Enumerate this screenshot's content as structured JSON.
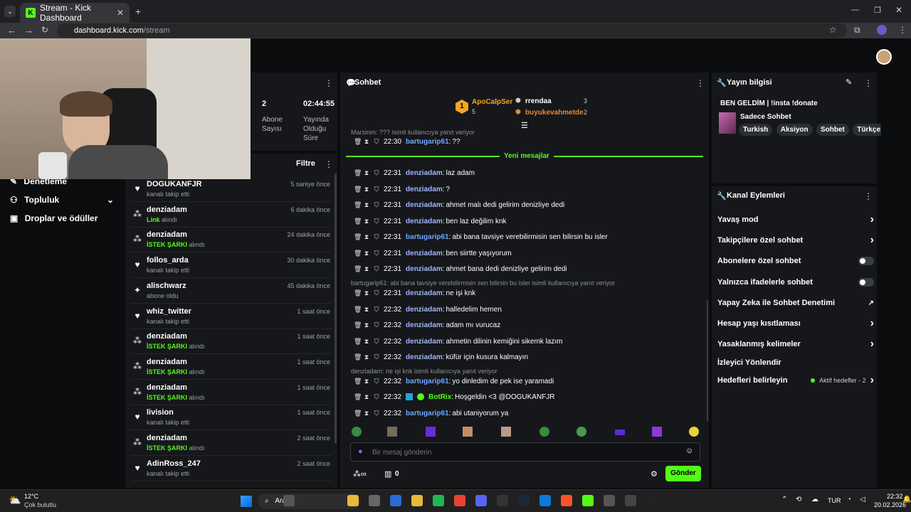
{
  "browser": {
    "tab_title": "Stream - Kick Dashboard",
    "url_host": "dashboard.kick.com",
    "url_path": "/stream"
  },
  "stats": {
    "subscribers_value": "2",
    "subscribers_label": "Abone Sayısı",
    "uptime_value": "02:44:55",
    "uptime_label": "Yayında Olduğu Süre"
  },
  "sidebar": {
    "items": [
      {
        "label": "Denetleme"
      },
      {
        "label": "Topluluk"
      },
      {
        "label": "Droplar ve ödüller"
      }
    ]
  },
  "activity": {
    "filter_label": "Filtre",
    "items": [
      {
        "name": "DOGUKANFJR",
        "highlight": "",
        "detail": "kanalı takip etti",
        "time": "5 saniye önce",
        "icon": "heart-icon"
      },
      {
        "name": "denziadam",
        "highlight": "Link",
        "detail": "alındı",
        "time": "6 dakika önce",
        "icon": "kick-points-icon"
      },
      {
        "name": "denziadam",
        "highlight": "İSTEK ŞARKI",
        "detail": "alındı",
        "time": "24 dakika önce",
        "icon": "kick-points-icon"
      },
      {
        "name": "follos_arda",
        "highlight": "",
        "detail": "kanalı takip etti",
        "time": "30 dakika önce",
        "icon": "heart-icon"
      },
      {
        "name": "alischwarz",
        "highlight": "",
        "detail": "abone oldu",
        "time": "45 dakika önce",
        "icon": "star-icon"
      },
      {
        "name": "whiz_twitter",
        "highlight": "",
        "detail": "kanalı takip etti",
        "time": "1 saat önce",
        "icon": "heart-icon"
      },
      {
        "name": "denziadam",
        "highlight": "İSTEK ŞARKI",
        "detail": "alındı",
        "time": "1 saat önce",
        "icon": "kick-points-icon"
      },
      {
        "name": "denziadam",
        "highlight": "İSTEK ŞARKI",
        "detail": "alındı",
        "time": "1 saat önce",
        "icon": "kick-points-icon"
      },
      {
        "name": "denziadam",
        "highlight": "İSTEK ŞARKI",
        "detail": "alındı",
        "time": "1 saat önce",
        "icon": "kick-points-icon"
      },
      {
        "name": "livision",
        "highlight": "",
        "detail": "kanalı takip etti",
        "time": "1 saat önce",
        "icon": "heart-icon"
      },
      {
        "name": "denziadam",
        "highlight": "İSTEK ŞARKI",
        "detail": "alındı",
        "time": "2 saat önce",
        "icon": "kick-points-icon"
      },
      {
        "name": "AdinRoss_247",
        "highlight": "",
        "detail": "kanalı takip etti",
        "time": "2 saat önce",
        "icon": "heart-icon"
      }
    ]
  },
  "chat": {
    "title": "Sohbet",
    "leaderboard": {
      "first_name": "ApoCalpSer",
      "first_count": "5",
      "rank": "1",
      "second_name": "rrendaa",
      "second_count": "3",
      "third_name": "buyukevahmetde",
      "third_count": "2"
    },
    "top_reply_note": "Marsiren: ??? isimli kullanıcıya yanıt veriyor",
    "new_messages_label": "Yeni mesajlar",
    "messages": [
      {
        "time": "22:30",
        "user": "bartugarip61",
        "text": "??"
      },
      {
        "time": "22:31",
        "user": "denziadam",
        "text": "laz adam"
      },
      {
        "time": "22:31",
        "user": "denziadam",
        "text": "?"
      },
      {
        "time": "22:31",
        "user": "denziadam",
        "text": "ahmet malı dedi gelirim denizliye dedi"
      },
      {
        "time": "22:31",
        "user": "denziadam",
        "text": "ben laz değilim knk"
      },
      {
        "time": "22:31",
        "user": "bartugarip61",
        "text": "abi bana tavsiye verebilirmisin sen bilirsin bu isler"
      },
      {
        "time": "22:31",
        "user": "denziadam",
        "text": "ben siirtte yaşıyorum"
      },
      {
        "time": "22:31",
        "user": "denziadam",
        "text": "ahmet bana dedi denizliye gelirim dedi"
      },
      {
        "time": "22:31",
        "user": "denziadam",
        "text": "ne işi knk"
      },
      {
        "time": "22:32",
        "user": "denziadam",
        "text": "halledelim hemen"
      },
      {
        "time": "22:32",
        "user": "denziadam",
        "text": "adam mı vurucaz"
      },
      {
        "time": "22:32",
        "user": "denziadam",
        "text": "ahmetin dilinin kemiğini sikemk lazım"
      },
      {
        "time": "22:32",
        "user": "denziadam",
        "text": "küfür için kusura kalmayın"
      },
      {
        "time": "22:32",
        "user": "bartugarip61",
        "text": "yo dinledim de pek ise yaramadi"
      },
      {
        "time": "22:32",
        "user": "BotRix",
        "text": "Hoşgeldin <3 @DOGUKANFJR"
      },
      {
        "time": "22:32",
        "user": "bartugarip61",
        "text": "abi utaniyorum ya"
      }
    ],
    "reply_notes": [
      "bartugarip61: abi bana tavsiye verebilirmisin sen bilirsin bu isler isimli kullanıcıya yanıt veriyor",
      "denziadam: ne işi knk isimli kullanıcıya yanıt veriyor"
    ],
    "input_placeholder": "Bir mesaj gönderin",
    "send_label": "Gönder",
    "points_count": "0"
  },
  "stream_info": {
    "title": "Yayın bilgisi",
    "stream_title": "BEN GELDİM | !insta !donate",
    "category": "Sadece Sohbet",
    "tags": [
      "Turkish",
      "Aksiyon",
      "Sohbet",
      "Türkçe"
    ]
  },
  "channel_actions": {
    "title": "Kanal Eylemleri",
    "rows": [
      {
        "label": "Yavaş mod",
        "control": "chevron"
      },
      {
        "label": "Takipçilere özel sohbet",
        "control": "chevron"
      },
      {
        "label": "Abonelere özel sohbet",
        "control": "toggle"
      },
      {
        "label": "Yalnızca ifadelerle sohbet",
        "control": "toggle"
      },
      {
        "label": "Yapay Zeka ile Sohbet Denetimi",
        "control": "external"
      },
      {
        "label": "Hesap yaşı kısıtlaması",
        "control": "chevron"
      },
      {
        "label": "Yasaklanmış kelimeler",
        "control": "chevron"
      },
      {
        "label": "İzleyici Yönlendir",
        "control": "none"
      },
      {
        "label": "Hedefleri belirleyin",
        "control": "chevron"
      }
    ],
    "goals_badge": "Aktif hedefler - 2"
  },
  "taskbar": {
    "weather_temp": "12°C",
    "weather_desc": "Çok bulutlu",
    "search_label": "Ara",
    "lang": "TUR",
    "time": "22:32",
    "date": "20.02.2026"
  },
  "colors": {
    "accent": "#53fc18",
    "bg": "#0b0c0d",
    "panel": "#16171a"
  }
}
